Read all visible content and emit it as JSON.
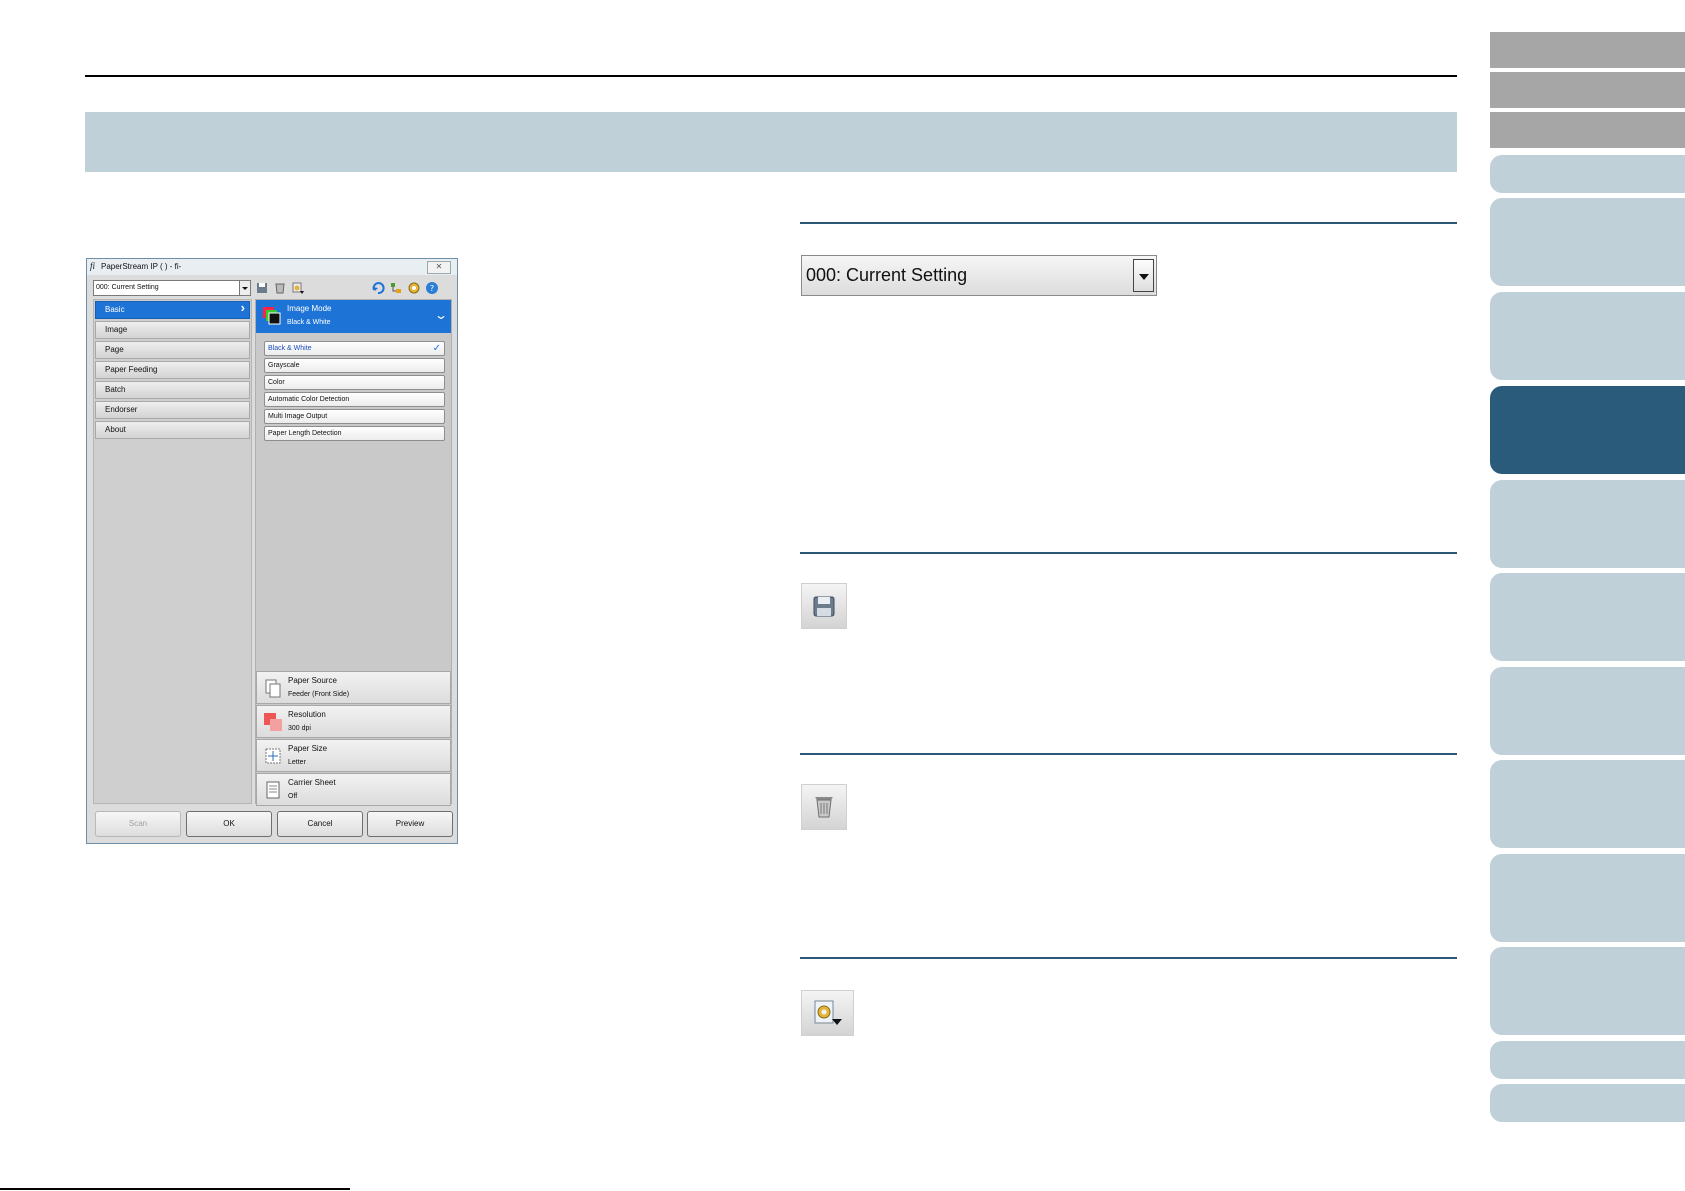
{
  "dialog": {
    "title": "PaperStream IP (        ) - fi-",
    "logo": "fi",
    "close_label": "✕",
    "profile": "000: Current Setting",
    "toolbar": [
      "save-icon",
      "delete-icon",
      "profile-menu-icon",
      "reset-icon",
      "tree-icon",
      "config-icon",
      "help-icon"
    ],
    "nav": [
      "Basic",
      "Image",
      "Page",
      "Paper Feeding",
      "Batch",
      "Endorser",
      "About"
    ],
    "image_mode": {
      "title": "Image Mode",
      "value": "Black & White"
    },
    "options": [
      "Black & White",
      "Grayscale",
      "Color",
      "Automatic Color Detection",
      "Multi Image Output",
      "Paper Length Detection"
    ],
    "summaries": [
      {
        "title": "Paper Source",
        "value": "Feeder (Front Side)"
      },
      {
        "title": "Resolution",
        "value": "300 dpi"
      },
      {
        "title": "Paper Size",
        "value": "Letter"
      },
      {
        "title": "Carrier Sheet",
        "value": "Off"
      }
    ],
    "buttons": [
      "Scan",
      "OK",
      "Cancel",
      "Preview"
    ]
  },
  "right": {
    "profile_combo": "000: Current Setting",
    "icons": [
      "save-icon",
      "delete-icon",
      "profile-settings-icon"
    ]
  },
  "colors": {
    "band": "#bfd0d9",
    "active_tab": "#2b5b7b",
    "rule": "#2c5775",
    "accent": "#1e74d6"
  }
}
